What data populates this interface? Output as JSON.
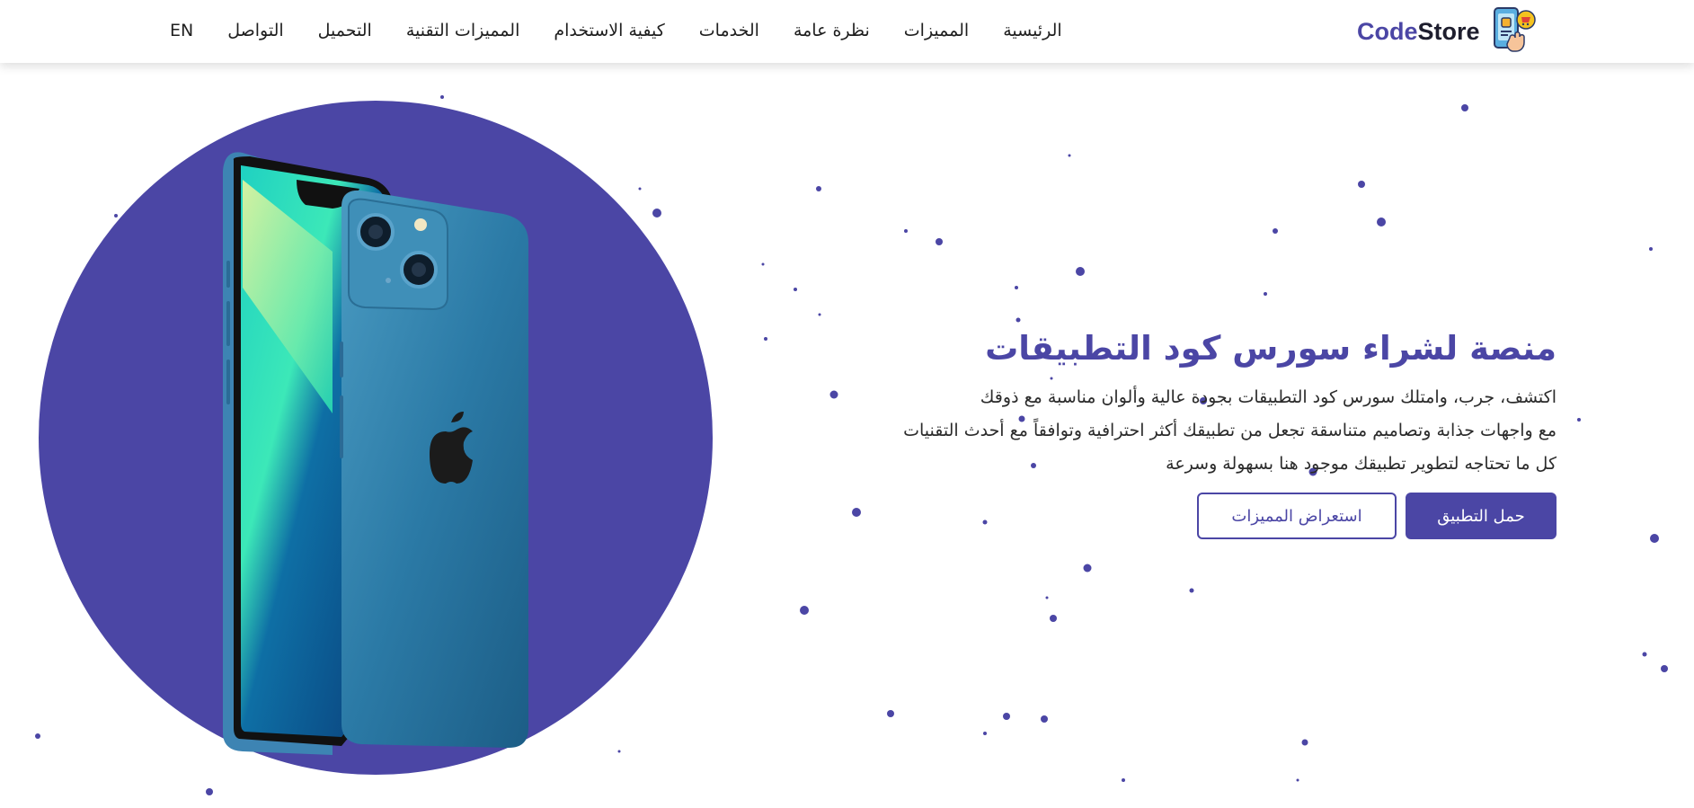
{
  "brand": {
    "name_part1": "Code",
    "name_part2": "Store",
    "accent_color": "#4b46a5"
  },
  "nav": {
    "items": [
      {
        "label": "EN",
        "name": "nav-lang-en"
      },
      {
        "label": "التواصل",
        "name": "nav-contact"
      },
      {
        "label": "التحميل",
        "name": "nav-download"
      },
      {
        "label": "المميزات التقنية",
        "name": "nav-tech-features"
      },
      {
        "label": "كيفية الاستخدام",
        "name": "nav-how-to-use"
      },
      {
        "label": "الخدمات",
        "name": "nav-services"
      },
      {
        "label": "نظرة عامة",
        "name": "nav-overview"
      },
      {
        "label": "المميزات",
        "name": "nav-features"
      },
      {
        "label": "الرئيسية",
        "name": "nav-home"
      }
    ]
  },
  "hero": {
    "title": "منصة لشراء سورس كود التطبيقات",
    "line1": "اكتشف، جرب، وامتلك سورس كود التطبيقات بجودة عالية وألوان مناسبة مع ذوقك",
    "line2": "مع واجهات جذابة وتصاميم متناسقة تجعل من تطبيقك أكثر احترافية وتوافقاً مع أحدث التقنيات",
    "line3": "كل ما تحتاجه لتطوير تطبيقك موجود هنا بسهولة وسرعة",
    "primary_button": "حمل التطبيق",
    "secondary_button": "استعراض المميزات"
  },
  "icons": {
    "logo": "store-logo-icon",
    "phone": "smartphone-image"
  },
  "colors": {
    "primary": "#4b46a5",
    "background": "#ffffff",
    "text": "#2b2b2b"
  }
}
